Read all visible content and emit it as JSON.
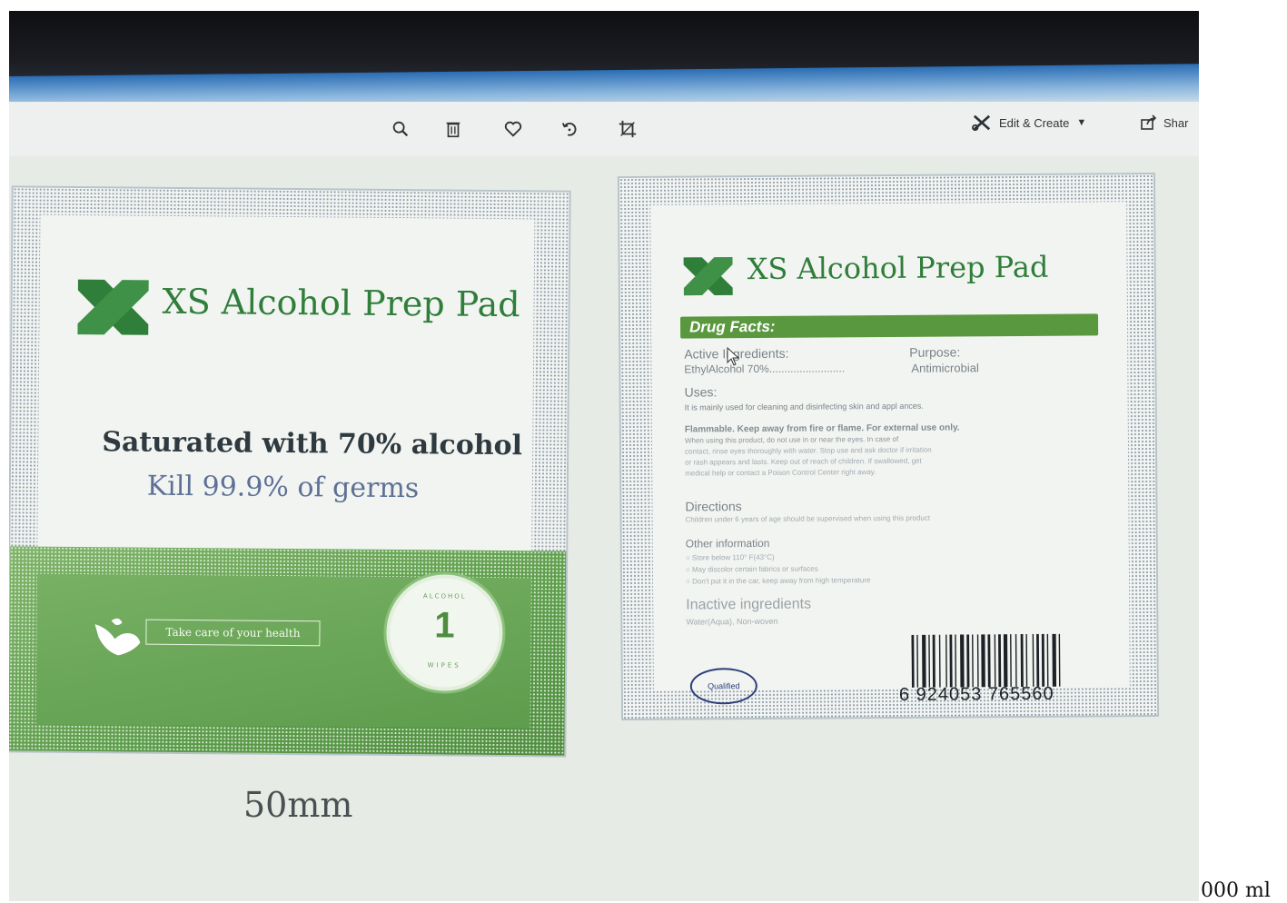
{
  "toolbar": {
    "edit_create_label": "Edit & Create",
    "share_label": "Shar",
    "icons": [
      "zoom-icon",
      "trash-icon",
      "heart-icon",
      "rotate-icon",
      "crop-icon"
    ]
  },
  "left_label": {
    "brand": "XS Alcohol Prep Pad",
    "headline": "Saturated with 70% alcohol",
    "subheadline": "Kill 99.9% of germs",
    "take_care": "Take care of your health",
    "badge_number": "1",
    "badge_top": "ALCOHOL",
    "badge_bottom": "WIPES",
    "size": "50mm",
    "accent": "#59983e"
  },
  "right_label": {
    "brand": "XS Alcohol Prep Pad",
    "drug_facts": "Drug Facts:",
    "active_heading": "Active Ingredients:",
    "purpose_heading": "Purpose:",
    "active_value": "EthylAlcohol 70%.........................",
    "purpose_value": "Antimicrobial",
    "uses_heading": "Uses:",
    "uses_text": "It is mainly used for cleaning and disinfecting skin and appl ances.",
    "warning_1": "Flammable. Keep away from fire or flame. For external use only.",
    "warning_2": "When using this product, do not use in or near the eyes. In case of",
    "warning_3": "contact, rinse eyes thoroughly with water. Stop use and ask doctor if irritation",
    "warning_4": "or rash appears and lasts. Keep out of reach of children. If swallowed, get",
    "warning_5": "medical help or contact a Poison Control Center right away.",
    "directions_heading": "Directions",
    "directions_text": "Children under 6 years of age should be supervised when using this product",
    "other_heading": "Other information",
    "other_1": "Store below 110° F(43°C)",
    "other_2": "May discolor certain fabrics or surfaces",
    "other_3": "Don't put it in the car, keep away from high temperature",
    "inactive_heading": "Inactive ingredients",
    "inactive_text": "Water(Aqua), Non-woven",
    "qualified": "Qualified",
    "barcode": "6 924053 765560"
  },
  "outside_text": "000 ml"
}
